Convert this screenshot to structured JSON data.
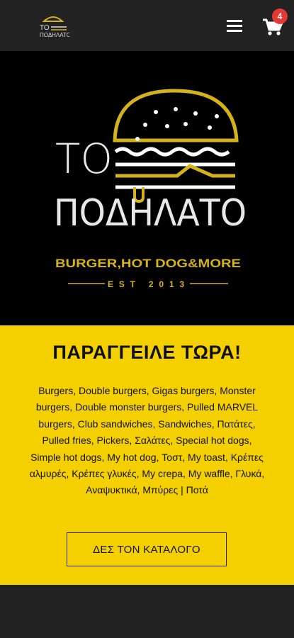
{
  "header": {
    "logo_line1": "ΤΟ",
    "logo_line2": "ΠΟΔΗΛΑΤΟ",
    "cart_count": "4",
    "menu_icon": "hamburger-menu-icon",
    "cart_icon": "shopping-cart-icon"
  },
  "hero": {
    "logo_to": "ΤΟ",
    "logo_name": "ΠΟΔΗΛΑΤΟ",
    "tagline": "BURGER,HOT DOG&MORE",
    "est": "EST 2013"
  },
  "order": {
    "title": "ΠΑΡΑΓΓΕΙΛΕ ΤΩΡΑ!",
    "categories": "Burgers, Double burgers, Gigas burgers, Monster burgers, Double monster burgers, Pulled MARVEL burgers, Club sandwiches, Sandwiches, Πατάτες, Pulled fries, Pickers, Σαλάτες, Special hot dogs, Simple hot dogs, My hot dog, Τοστ, My toast, Κρέπες αλμυρές, Κρέπες γλυκές, My crepa, My waffle, Γλυκά, Αναψυκτικά, Μπύρες | Ποτά",
    "catalog_button": "ΔΕΣ ΤΟΝ ΚΑΤΑΛΟΓΟ"
  },
  "colors": {
    "brand_yellow": "#f5d000",
    "logo_gold": "#d4b21a",
    "background": "#222222",
    "badge_red": "#e53935"
  }
}
